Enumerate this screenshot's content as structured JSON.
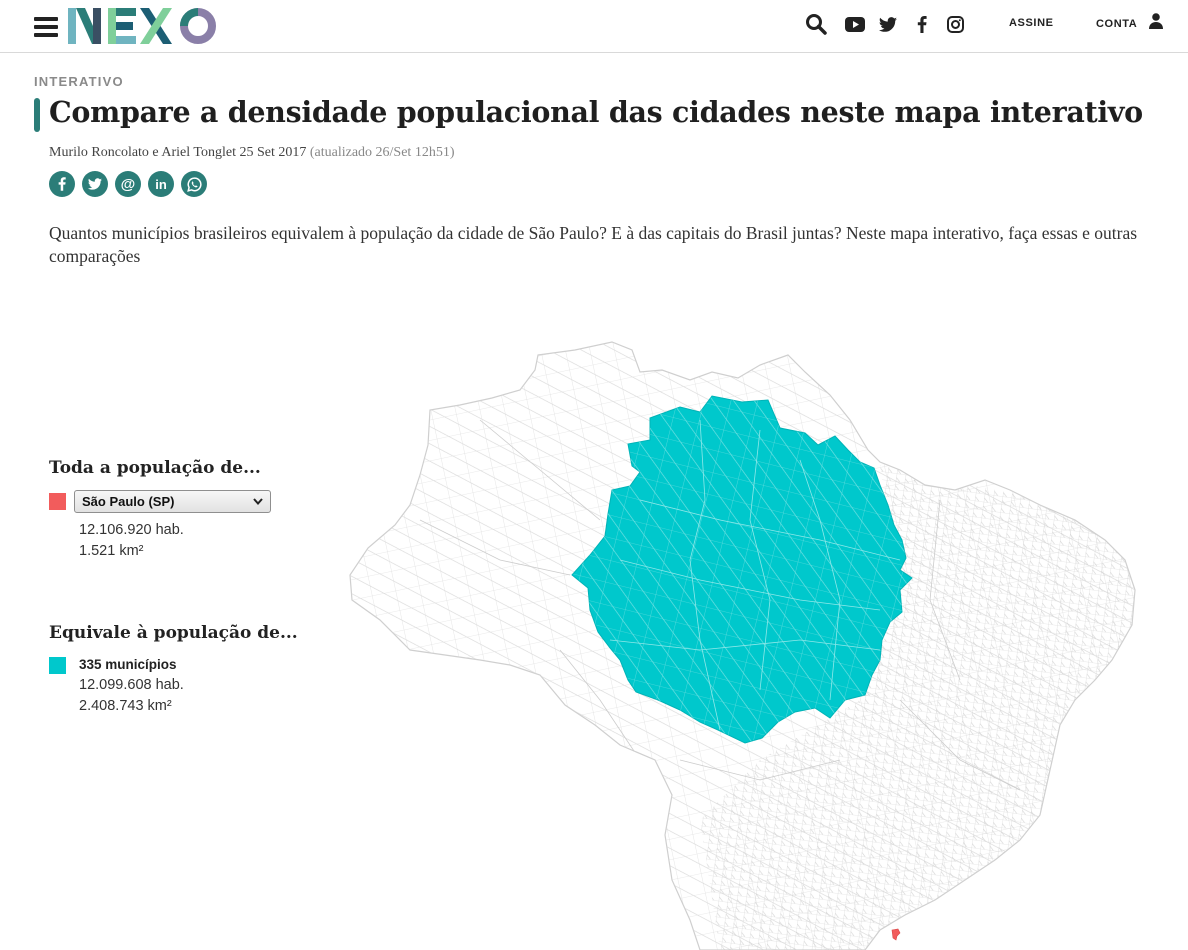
{
  "header": {
    "logo_text": "NEXO",
    "nav_links": {
      "subscribe": "ASSINE",
      "account": "CONTA"
    },
    "icons": [
      "menu-icon",
      "search-icon",
      "youtube-icon",
      "twitter-icon",
      "facebook-icon",
      "instagram-icon",
      "user-icon"
    ]
  },
  "article": {
    "kicker": "INTERATIVO",
    "title": "Compare a densidade populacional das cidades neste mapa interativo",
    "byline": "Murilo Roncolato e Ariel Tonglet 25 Set 2017",
    "updated": "(atualizado 26/Set 12h51)",
    "intro": "Quantos municípios brasileiros equivalem à população da cidade de São Paulo? E à das capitais do Brasil juntas? Neste mapa interativo, faça essas e outras comparações",
    "share": [
      {
        "icon": "facebook-share-icon",
        "glyph": "f"
      },
      {
        "icon": "twitter-share-icon",
        "glyph": "t"
      },
      {
        "icon": "email-share-icon",
        "glyph": "@"
      },
      {
        "icon": "linkedin-share-icon",
        "glyph": "in"
      },
      {
        "icon": "whatsapp-share-icon",
        "glyph": "w"
      }
    ]
  },
  "panel": {
    "source": {
      "heading": "Toda a população de...",
      "selected": "São Paulo (SP)",
      "population": "12.106.920 hab.",
      "area": "1.521 km²",
      "color": "#f25c5c"
    },
    "equivalent": {
      "heading": "Equivale à população de...",
      "count": "335 municípios",
      "population": "12.099.608 hab.",
      "area": "2.408.743 km²",
      "color": "#00c8cc"
    }
  },
  "colors": {
    "brand_teal": "#2b7d78",
    "highlight": "#00c8cc",
    "source": "#f25c5c",
    "municipality_border": "#d2d2d2"
  }
}
